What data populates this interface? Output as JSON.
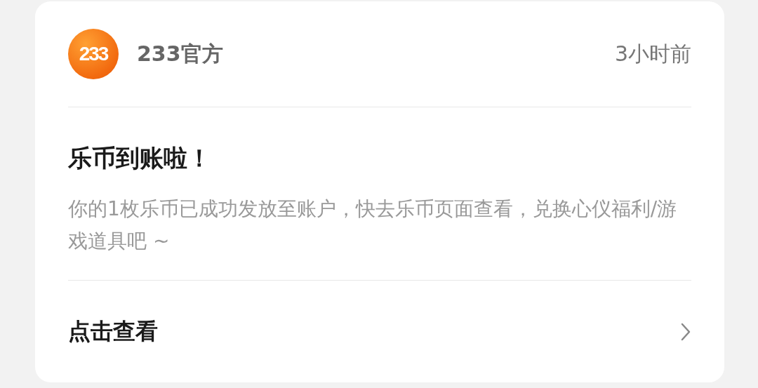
{
  "sender": {
    "logo_text": "233",
    "name": "233官方",
    "time": "3小时前"
  },
  "message": {
    "title": "乐币到账啦！",
    "body": "你的1枚乐币已成功发放至账户，快去乐币页面查看，兑换心仪福利/游戏道具吧 ~"
  },
  "action": {
    "label": "点击查看"
  }
}
